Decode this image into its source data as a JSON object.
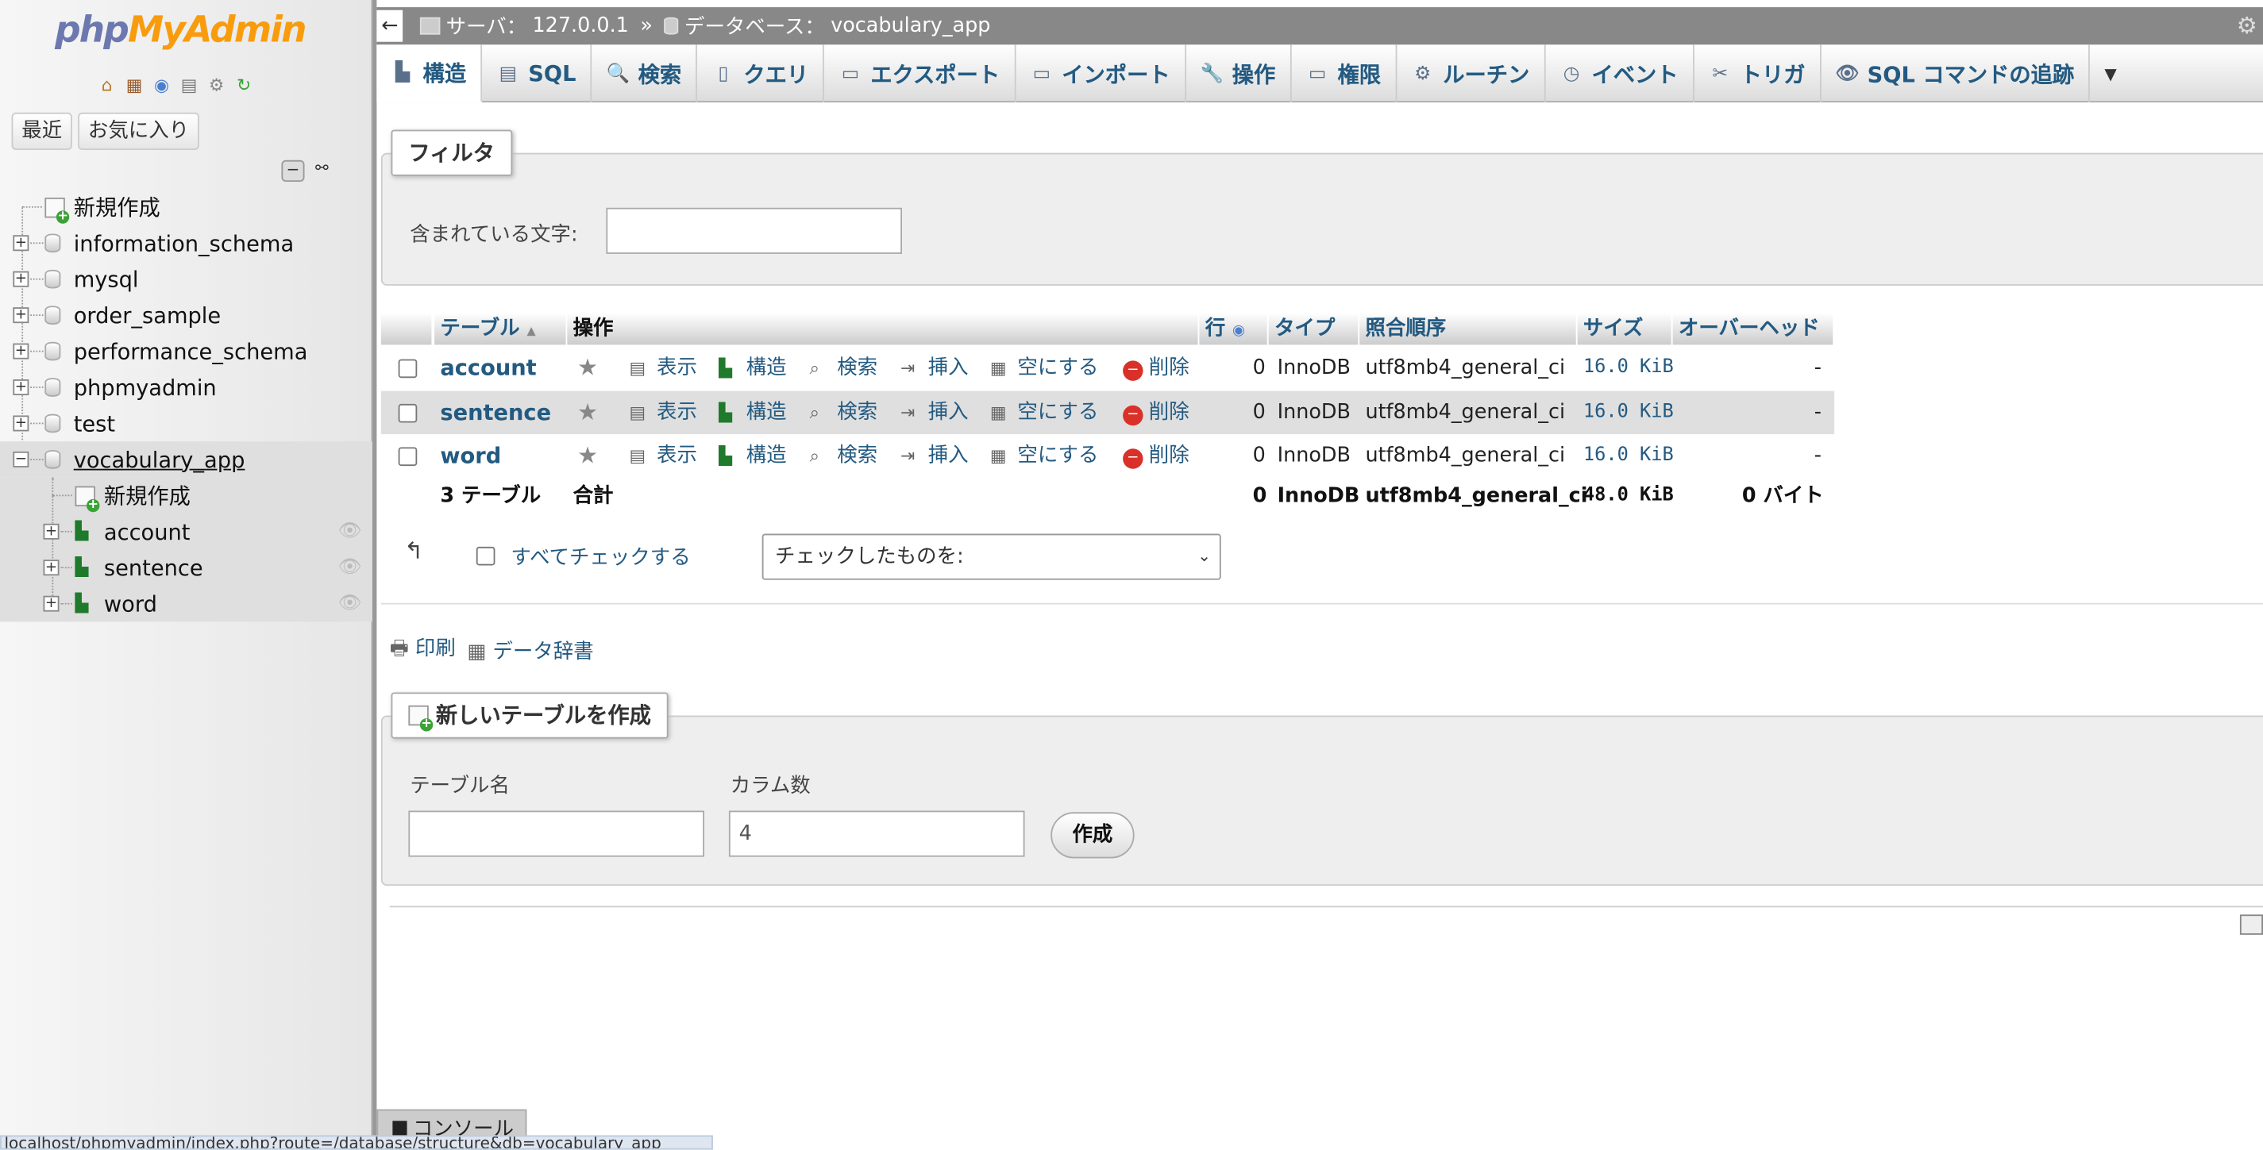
{
  "logo": {
    "php": "php",
    "myadmin": "MyAdmin"
  },
  "nav_icons": [
    "home-icon",
    "database-icon",
    "help-icon",
    "docs-icon",
    "settings-icon",
    "reload-icon"
  ],
  "nav_buttons": {
    "recent": "最近",
    "favorites": "お気に入り"
  },
  "tree": {
    "new": "新規作成",
    "databases": [
      "information_schema",
      "mysql",
      "order_sample",
      "performance_schema",
      "phpmyadmin",
      "test"
    ],
    "current_db": "vocabulary_app",
    "current_new": "新規作成",
    "tables": [
      "account",
      "sentence",
      "word"
    ]
  },
  "breadcrumb": {
    "server_label": "サーバ：",
    "server": "127.0.0.1",
    "sep": "»",
    "db_label": "データベース：",
    "db": "vocabulary_app"
  },
  "tabs": [
    {
      "label": "構造",
      "icon": "structure-icon"
    },
    {
      "label": "SQL",
      "icon": "sql-icon"
    },
    {
      "label": "検索",
      "icon": "search-icon"
    },
    {
      "label": "クエリ",
      "icon": "query-icon"
    },
    {
      "label": "エクスポート",
      "icon": "export-icon"
    },
    {
      "label": "インポート",
      "icon": "import-icon"
    },
    {
      "label": "操作",
      "icon": "wrench-icon"
    },
    {
      "label": "権限",
      "icon": "privileges-icon"
    },
    {
      "label": "ルーチン",
      "icon": "routines-icon"
    },
    {
      "label": "イベント",
      "icon": "events-icon"
    },
    {
      "label": "トリガ",
      "icon": "triggers-icon"
    },
    {
      "label": "SQL コマンドの追跡",
      "icon": "eye-icon"
    }
  ],
  "tabs_more": "▼",
  "filter": {
    "legend": "フィルタ",
    "label": "含まれている文字:",
    "value": ""
  },
  "table": {
    "headers": {
      "table": "テーブル",
      "ops": "操作",
      "rows": "行",
      "type": "タイプ",
      "collation": "照合順序",
      "size": "サイズ",
      "overhead": "オーバーヘッド"
    },
    "actions": {
      "browse": "表示",
      "structure": "構造",
      "search": "検索",
      "insert": "挿入",
      "empty": "空にする",
      "drop": "削除"
    },
    "rows": [
      {
        "name": "account",
        "rows": "0",
        "type": "InnoDB",
        "collation": "utf8mb4_general_ci",
        "size": "16.0 KiB",
        "overhead": "-"
      },
      {
        "name": "sentence",
        "rows": "0",
        "type": "InnoDB",
        "collation": "utf8mb4_general_ci",
        "size": "16.0 KiB",
        "overhead": "-"
      },
      {
        "name": "word",
        "rows": "0",
        "type": "InnoDB",
        "collation": "utf8mb4_general_ci",
        "size": "16.0 KiB",
        "overhead": "-"
      }
    ],
    "total": {
      "count": "3 テーブル",
      "label": "合計",
      "rows": "0",
      "type": "InnoDB",
      "collation": "utf8mb4_general_ci",
      "size": "48.0 KiB",
      "overhead": "0 バイト"
    }
  },
  "bulk": {
    "check_all": "すべてチェックする",
    "select": "チェックしたものを:"
  },
  "links": {
    "print": "印刷",
    "dictionary": "データ辞書"
  },
  "create": {
    "legend": "新しいテーブルを作成",
    "name_label": "テーブル名",
    "name_value": "",
    "cols_label": "カラム数",
    "cols_value": "4",
    "button": "作成"
  },
  "console": "コンソール",
  "status_url": "localhost/phpmyadmin/index.php?route=/database/structure&db=vocabulary_app"
}
